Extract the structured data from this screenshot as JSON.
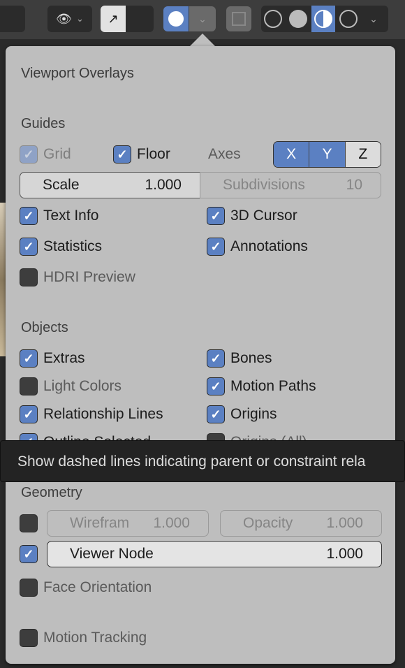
{
  "header": {
    "icons": [
      "selectability-visibility-icon",
      "gizmo-icon",
      "overlays-icon",
      "xray-icon",
      "wireframe-shading-icon",
      "solid-shading-icon",
      "material-preview-icon",
      "rendered-shading-icon"
    ],
    "accent": "#5b80c2"
  },
  "panel": {
    "title": "Viewport Overlays",
    "guides": {
      "header": "Guides",
      "grid": {
        "label": "Grid",
        "checked": true,
        "enabled": false
      },
      "floor": {
        "label": "Floor",
        "checked": true
      },
      "axes_label": "Axes",
      "axes": [
        {
          "label": "X",
          "active": true
        },
        {
          "label": "Y",
          "active": true
        },
        {
          "label": "Z",
          "active": false
        }
      ],
      "scale": {
        "label": "Scale",
        "value": "1.000"
      },
      "subdivisions": {
        "label": "Subdivisions",
        "value": "10"
      },
      "text_info": {
        "label": "Text Info",
        "checked": true
      },
      "cursor_3d": {
        "label": "3D Cursor",
        "checked": true
      },
      "statistics": {
        "label": "Statistics",
        "checked": true
      },
      "annotations": {
        "label": "Annotations",
        "checked": true
      },
      "hdri_preview": {
        "label": "HDRI Preview",
        "checked": false
      }
    },
    "objects": {
      "header": "Objects",
      "extras": {
        "label": "Extras",
        "checked": true
      },
      "bones": {
        "label": "Bones",
        "checked": true
      },
      "light_colors": {
        "label": "Light Colors",
        "checked": false
      },
      "motion_paths": {
        "label": "Motion Paths",
        "checked": true
      },
      "relationship_lines": {
        "label": "Relationship Lines",
        "checked": true
      },
      "origins": {
        "label": "Origins",
        "checked": true
      },
      "outline_selected": {
        "label": "Outline Selected",
        "checked": true
      },
      "origins_all": {
        "label": "Origins (All)",
        "checked": false
      }
    },
    "geometry": {
      "header": "Geometry",
      "wireframe": {
        "label": "Wirefram",
        "value": "1.000",
        "checked": false
      },
      "opacity": {
        "label": "Opacity",
        "value": "1.000"
      },
      "viewer_node": {
        "label": "Viewer Node",
        "value": "1.000",
        "checked": true
      },
      "face_orientation": {
        "label": "Face Orientation",
        "checked": false
      },
      "motion_tracking": {
        "label": "Motion Tracking",
        "checked": false
      }
    }
  },
  "tooltip": {
    "text": "Show dashed lines indicating parent or constraint rela"
  }
}
